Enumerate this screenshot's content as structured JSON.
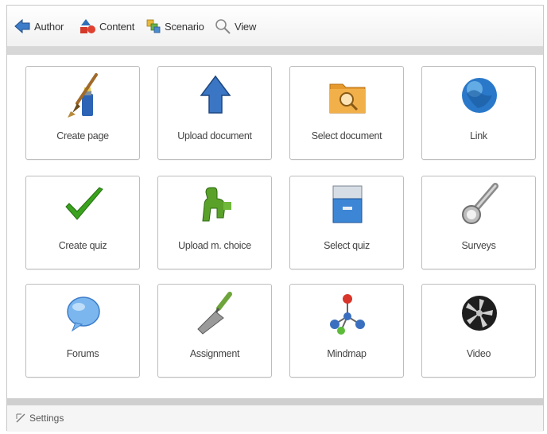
{
  "toolbar": {
    "items": [
      {
        "label": "Author",
        "icon": "author-back-arrow-icon"
      },
      {
        "label": "Content",
        "icon": "content-shapes-icon"
      },
      {
        "label": "Scenario",
        "icon": "scenario-icon"
      },
      {
        "label": "View",
        "icon": "magnifier-icon"
      }
    ]
  },
  "tiles": [
    {
      "label": "Create page",
      "icon": "paintbrush-icon"
    },
    {
      "label": "Upload document",
      "icon": "upload-arrow-icon"
    },
    {
      "label": "Select document",
      "icon": "folder-search-icon"
    },
    {
      "label": "Link",
      "icon": "globe-icon"
    },
    {
      "label": "Create quiz",
      "icon": "checkmark-icon"
    },
    {
      "label": "Upload m. choice",
      "icon": "upload-choice-icon"
    },
    {
      "label": "Select quiz",
      "icon": "drawer-icon"
    },
    {
      "label": "Surveys",
      "icon": "flashlight-icon"
    },
    {
      "label": "Forums",
      "icon": "speech-bubble-icon"
    },
    {
      "label": "Assignment",
      "icon": "trowel-icon"
    },
    {
      "label": "Mindmap",
      "icon": "molecule-icon"
    },
    {
      "label": "Video",
      "icon": "film-reel-icon"
    }
  ],
  "footer": {
    "settings_label": "Settings",
    "settings_icon": "settings-icon"
  },
  "colors": {
    "accent_blue": "#2f6fb8",
    "check_green": "#3aa21e",
    "folder_orange": "#e69a2e"
  }
}
